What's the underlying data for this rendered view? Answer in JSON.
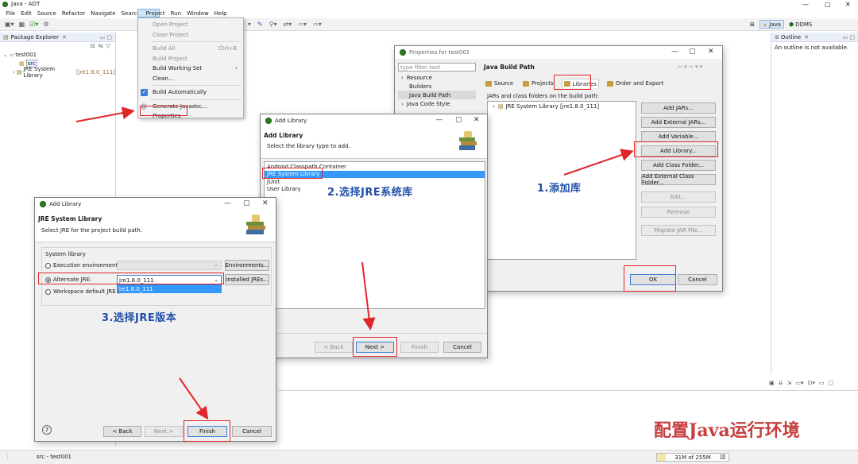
{
  "app": {
    "title": "Java - ADT"
  },
  "menubar": [
    "File",
    "Edit",
    "Source",
    "Refactor",
    "Navigate",
    "Search",
    "Project",
    "Run",
    "Window",
    "Help"
  ],
  "perspectives": {
    "java": "Java",
    "ddms": "DDMS"
  },
  "package_explorer": {
    "title": "Package Explorer",
    "project": "test001",
    "src": "src",
    "jre_prefix": "JRE System Library",
    "jre_suffix": "[jre1.8.0_111]"
  },
  "outline": {
    "title": "Outline",
    "message": "An outline is not available."
  },
  "project_menu": {
    "items": [
      {
        "label": "Open Project",
        "shortcut": "",
        "disabled": true
      },
      {
        "label": "Close Project",
        "shortcut": "",
        "disabled": true
      },
      {
        "label": "Build All",
        "shortcut": "Ctrl+B",
        "disabled": true
      },
      {
        "label": "Build Project",
        "shortcut": "",
        "disabled": true
      },
      {
        "label": "Build Working Set",
        "shortcut": "",
        "disabled": false
      },
      {
        "label": "Clean...",
        "shortcut": "",
        "disabled": false
      },
      {
        "label": "Build Automatically",
        "shortcut": "",
        "disabled": false
      },
      {
        "label": "Generate Javadoc...",
        "shortcut": "",
        "disabled": false
      },
      {
        "label": "Properties",
        "shortcut": "",
        "disabled": false
      }
    ]
  },
  "properties_dialog": {
    "title": "Properties for test001",
    "filter_placeholder": "type filter text",
    "tree": [
      "Resource",
      "Builders",
      "Java Build Path",
      "Java Code Style"
    ],
    "heading": "Java Build Path",
    "tabs": [
      "Source",
      "Projects",
      "Libraries",
      "Order and Export"
    ],
    "desc": "JARs and class folders on the build path:",
    "lib_entry": "JRE System Library [jre1.8.0_111]",
    "buttons": [
      "Add JARs...",
      "Add External JARs...",
      "Add Variable...",
      "Add Library...",
      "Add Class Folder...",
      "Add External Class Folder...",
      "Edit...",
      "Remove",
      "Migrate JAR File..."
    ],
    "ok": "OK",
    "cancel": "Cancel"
  },
  "add_library_dialog": {
    "title": "Add Library",
    "heading": "Add Library",
    "subtitle": "Select the library type to add.",
    "items": [
      "Android Classpath Container",
      "JRE System Library",
      "JUnit",
      "User Library"
    ],
    "back": "< Back",
    "next": "Next >",
    "finish": "Finish",
    "cancel": "Cancel"
  },
  "jre_dialog": {
    "title": "Add Library",
    "heading": "JRE System Library",
    "subtitle": "Select JRE for the project build path.",
    "group": "System library",
    "opt_exec": "Execution environment:",
    "opt_alt": "Alternate JRE:",
    "opt_ws": "Workspace default JRE (",
    "alt_value": "jre1.8.0_111",
    "dropdown_value": "jre1.8.0_111",
    "btn_env": "Environments...",
    "btn_installed": "Installed JREs...",
    "back": "< Back",
    "next": "Next >",
    "finish": "Finish",
    "cancel": "Cancel"
  },
  "annotations": {
    "step1": "1.添加库",
    "step2": "2.选择JRE系统库",
    "step3": "3.选择JRE版本"
  },
  "status": {
    "left": "src - test001",
    "memory": "31M of 255M"
  },
  "watermark": {
    "text": "配置Java运行环境"
  },
  "colors": {
    "annotation": "#1f4ea8",
    "highlight": "#e0262b",
    "selection": "#3399ff"
  }
}
